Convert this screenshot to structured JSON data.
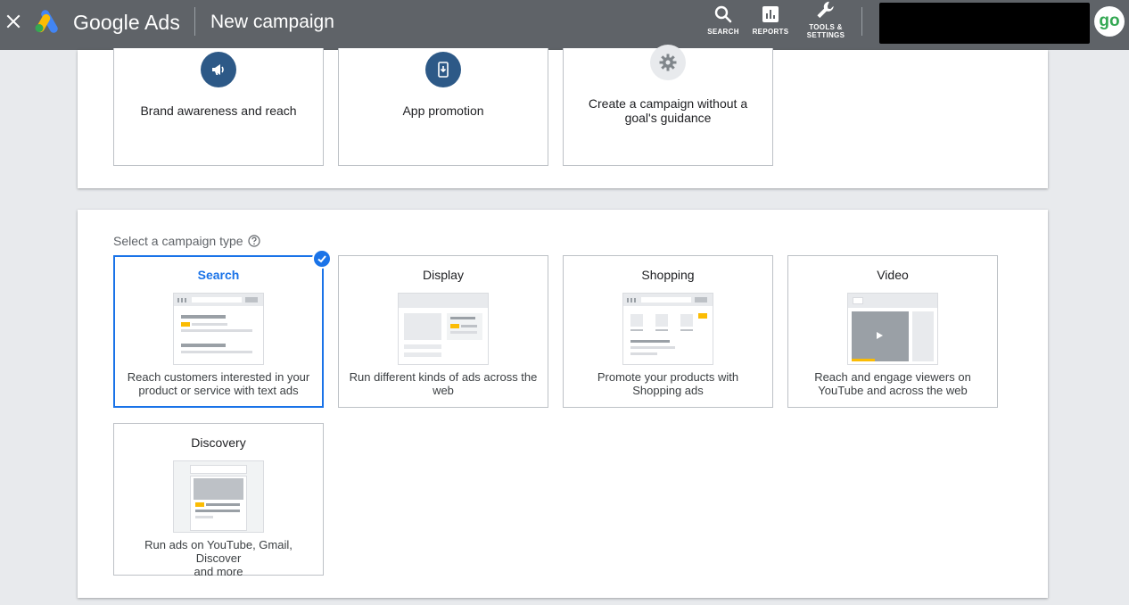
{
  "header": {
    "product_name": "Google Ads",
    "page_title": "New campaign",
    "actions": [
      {
        "id": "search",
        "label": "SEARCH",
        "icon": "search-icon"
      },
      {
        "id": "reports",
        "label": "REPORTS",
        "icon": "reports-icon"
      },
      {
        "id": "tools",
        "label_line1": "TOOLS &",
        "label_line2": "SETTINGS",
        "icon": "wrench-icon"
      }
    ],
    "avatar_text": "go"
  },
  "goals": [
    {
      "label": "Brand awareness and reach",
      "icon": "megaphone-icon"
    },
    {
      "label": "App promotion",
      "icon": "phone-download-icon"
    },
    {
      "label_line1": "Create a campaign without a",
      "label_line2": "goal's guidance",
      "icon": "gear-icon"
    }
  ],
  "campaign_types": {
    "section_label": "Select a campaign type",
    "items": [
      {
        "title": "Search",
        "desc_line1": "Reach customers interested in your",
        "desc_line2": "product or service with text ads",
        "selected": true
      },
      {
        "title": "Display",
        "desc_line1": "Run different kinds of ads across the",
        "desc_line2": "web",
        "selected": false
      },
      {
        "title": "Shopping",
        "desc_line1": "Promote your products with",
        "desc_line2": "Shopping ads",
        "selected": false
      },
      {
        "title": "Video",
        "desc_line1": "Reach and engage viewers on",
        "desc_line2": "YouTube and across the web",
        "selected": false
      },
      {
        "title": "Discovery",
        "desc_line1": "Run ads on YouTube, Gmail, Discover",
        "desc_line2": "and more",
        "selected": false
      }
    ]
  },
  "colors": {
    "header_bg": "#5f6368",
    "accent_blue": "#1a73e8",
    "goal_icon_blue": "#2d5987",
    "illustration_yellow": "#fbbc04"
  }
}
